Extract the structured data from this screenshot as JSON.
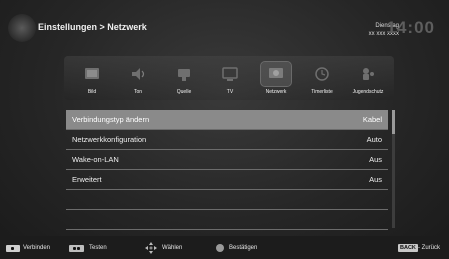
{
  "header": {
    "title": "Einstellungen > Netzwerk",
    "date_line1": "Dienstag",
    "date_line2": "xx xxx xxxx",
    "clock": "14:00"
  },
  "menu": {
    "items": [
      {
        "label": "Bild",
        "icon": "picture-icon"
      },
      {
        "label": "Ton",
        "icon": "sound-icon"
      },
      {
        "label": "Quelle",
        "icon": "source-icon"
      },
      {
        "label": "TV",
        "icon": "tv-icon"
      },
      {
        "label": "Netzwerk",
        "icon": "network-icon"
      },
      {
        "label": "Timerliste",
        "icon": "timer-icon"
      },
      {
        "label": "Jugendschutz",
        "icon": "parental-icon"
      }
    ],
    "selected": "Netzwerk"
  },
  "settings": {
    "rows": [
      {
        "label": "Verbindungstyp ändern",
        "value": "Kabel"
      },
      {
        "label": "Netzwerkkonfiguration",
        "value": "Auto"
      },
      {
        "label": "Wake-on-LAN",
        "value": "Aus"
      },
      {
        "label": "Erweitert",
        "value": "Aus"
      },
      {
        "label": "",
        "value": ""
      },
      {
        "label": "",
        "value": ""
      }
    ],
    "active_index": 0
  },
  "footer": {
    "connect": "Verbinden",
    "test": "Testen",
    "select": "Wählen",
    "confirm": "Bestätigen",
    "back_key": "BACK",
    "back": "Zurück"
  },
  "colors": {
    "active_row": "#8a8a8a",
    "background": "#262626"
  }
}
